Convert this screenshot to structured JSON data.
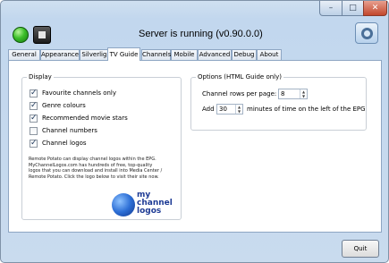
{
  "window": {
    "controls": {
      "minimize": "–",
      "maximize": "□",
      "close": "✕"
    }
  },
  "header": {
    "status": "Server is running (v0.90.0.0)",
    "icons": {
      "start": "go-icon",
      "stop": "stop-icon",
      "settings": "settings-icon"
    }
  },
  "tabs": [
    {
      "label": "General"
    },
    {
      "label": "Appearance"
    },
    {
      "label": "Silverlight"
    },
    {
      "label": "TV Guide"
    },
    {
      "label": "Channels"
    },
    {
      "label": "Mobile"
    },
    {
      "label": "Advanced"
    },
    {
      "label": "Debug"
    },
    {
      "label": "About"
    }
  ],
  "active_tab": "TV Guide",
  "display": {
    "title": "Display",
    "options": [
      {
        "label": "Favourite channels only",
        "checked": true
      },
      {
        "label": "Genre colours",
        "checked": true
      },
      {
        "label": "Recommended movie stars",
        "checked": true
      },
      {
        "label": "Channel numbers",
        "checked": false
      },
      {
        "label": "Channel logos",
        "checked": true
      }
    ],
    "description": "Remote Potato can display channel logos within the EPG. MyChannelLogos.com has hundreds of free, top-quality logos that you can download and install into Media Center / Remote Potato. Click the logo below to visit their site now.",
    "logo_text": [
      "my",
      "channel",
      "logos"
    ]
  },
  "options": {
    "title": "Options (HTML Guide only)",
    "rows_label": "Channel rows per page:",
    "rows_value": "8",
    "add_label": "Add",
    "add_value": "30",
    "add_suffix": "minutes of time on the left of the EPG"
  },
  "footer": {
    "quit_label": "Quit"
  },
  "colors": {
    "window_frame": "#c2d7ee",
    "accent": "#1e3b95"
  }
}
